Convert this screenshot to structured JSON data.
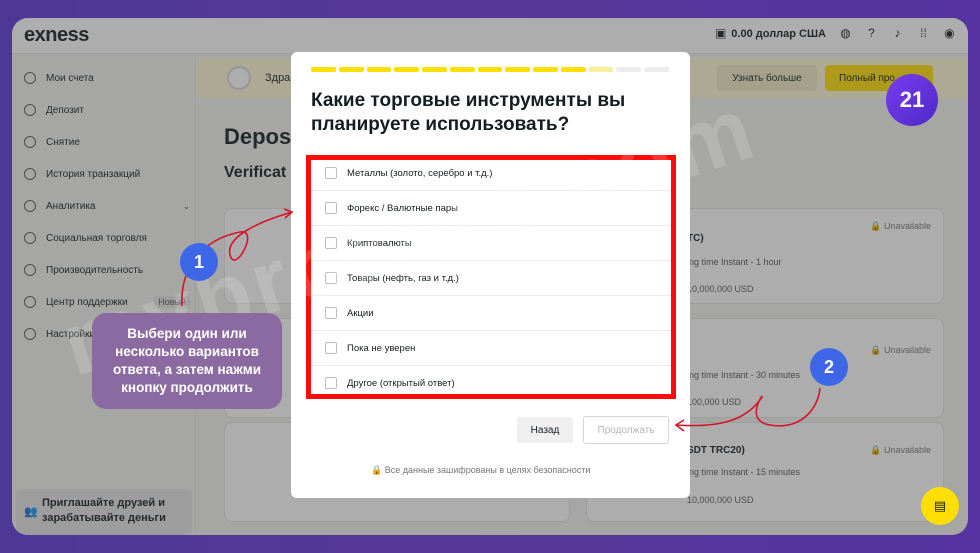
{
  "topbar": {
    "logo": "exness",
    "balance": "0.00 доллар США"
  },
  "sidebar": {
    "items": [
      {
        "label": "Мои счета"
      },
      {
        "label": "Депозит"
      },
      {
        "label": "Снятие"
      },
      {
        "label": "История транзакций"
      },
      {
        "label": "Аналитика"
      },
      {
        "label": "Социальная торговля"
      },
      {
        "label": "Производительность"
      },
      {
        "label": "Центр поддержки",
        "badge": "Новый"
      },
      {
        "label": "Настройки"
      }
    ],
    "invite_line1": "Приглашайте друзей и",
    "invite_line2": "зарабатывайте деньги"
  },
  "banner": {
    "greeting": "Здра",
    "more_button": "Узнать больше",
    "full_button": "Полный про"
  },
  "main": {
    "title": "Depos",
    "subtitle": "Verificat",
    "cards": [
      {
        "name_tail": "TC)",
        "time": "ing time Instant - 1 hour",
        "limits": "10,000,000 USD",
        "status": "Unavailable"
      },
      {
        "name_tail": "",
        "time": "ing time Instant - 30 minutes",
        "limits": "100,000 USD",
        "status": "Unavailable"
      },
      {
        "name_tail": "SDT TRC20)",
        "time": "ing time Instant - 15 minutes",
        "limits": "10,000,000 USD",
        "status": "Unavailable"
      }
    ]
  },
  "modal": {
    "question": "Какие торговые инструменты вы планируете использовать?",
    "progress": 0.78,
    "options": [
      "Металлы (золото, серебро и т.д.)",
      "Форекс / Валютные пары",
      "Криптовалюты",
      "Товары (нефть, газ и т.д.)",
      "Акции",
      "Пока не уверен",
      "Другое (открытый ответ)"
    ],
    "back_button": "Назад",
    "continue_button": "Продолжать",
    "secure_note": "Все данные зашифрованы в целях безопасности"
  },
  "annotations": {
    "tip": "Выбери один или несколько вариантов ответа, а затем нажми кнопку продолжить",
    "step1": "1",
    "step2": "2",
    "step_badge": "21",
    "watermark": "mybrokers.com"
  },
  "colors": {
    "accent_yellow": "#ffde02",
    "highlight_red": "#ff0a0a",
    "step_blue": "#3d67e6",
    "background_purple": "#5a37d6"
  }
}
